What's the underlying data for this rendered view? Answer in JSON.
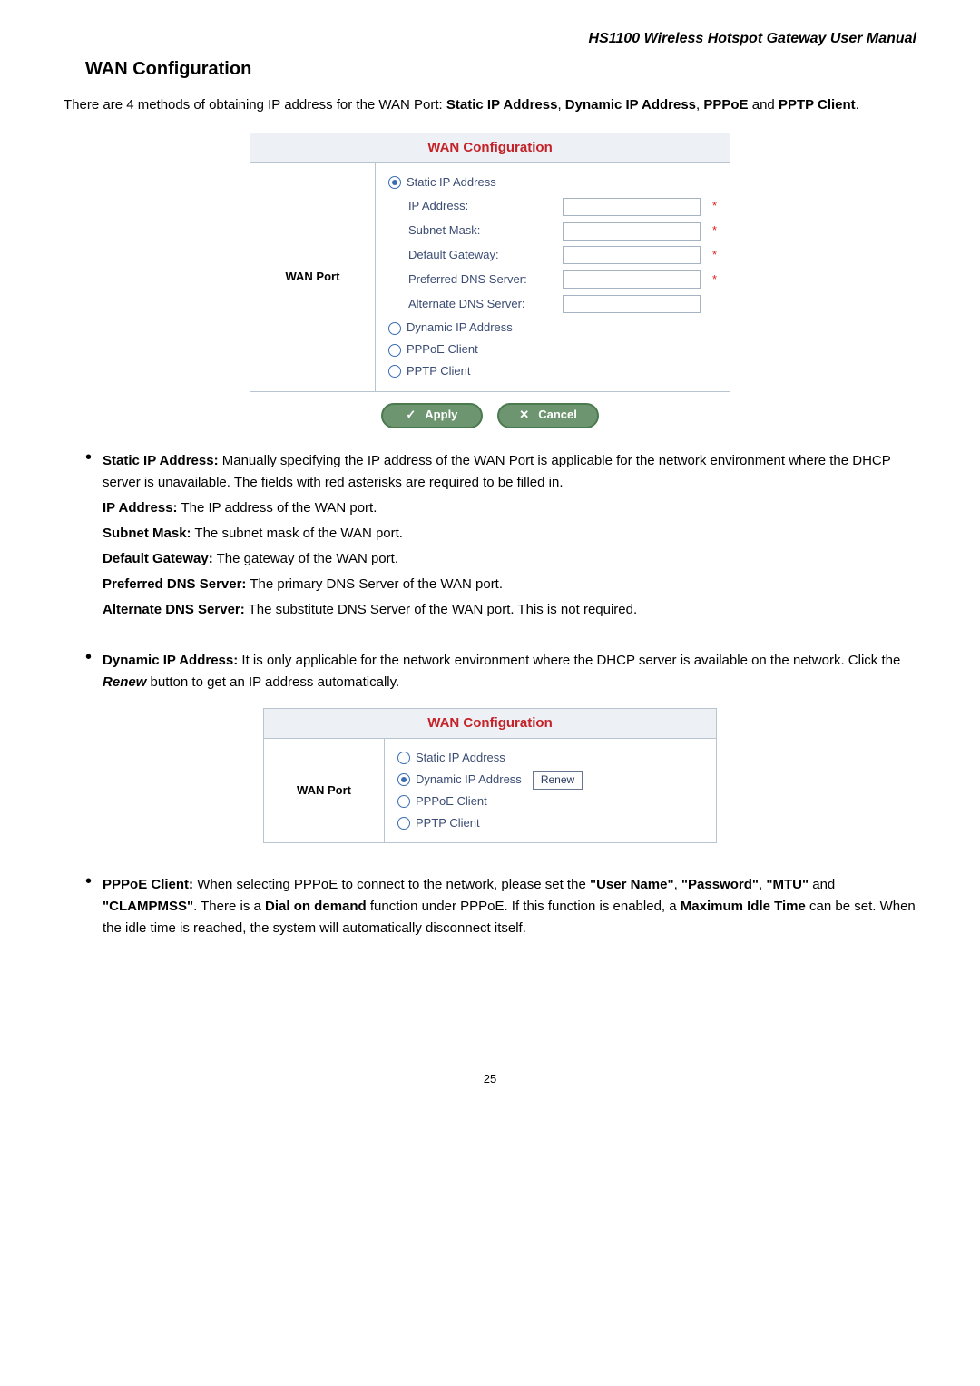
{
  "document_header": "HS1100  Wireless  Hotspot  Gateway  User  Manual",
  "section_title": "WAN Configuration",
  "intro_parts": {
    "p1": "There are 4 methods of obtaining IP address for the WAN Port: ",
    "m1": "Static IP Address",
    "sep1": ", ",
    "m2": "Dynamic IP Address",
    "sep2": ", ",
    "m3": "PPPoE",
    "p2": " and ",
    "m4": "PPTP Client",
    "p3": "."
  },
  "config1": {
    "title": "WAN Configuration",
    "leftlabel": "WAN Port",
    "radios": {
      "static": "Static IP Address",
      "dynamic": "Dynamic IP Address",
      "pppoe": "PPPoE Client",
      "pptp": "PPTP Client"
    },
    "fields": {
      "ip": "IP Address:",
      "subnet": "Subnet Mask:",
      "gateway": "Default Gateway:",
      "pref_dns": "Preferred DNS Server:",
      "alt_dns": "Alternate DNS Server:"
    },
    "apply": "Apply",
    "cancel": "Cancel"
  },
  "static_block": {
    "lead": "Static IP Address:",
    "text1": " Manually specifying the IP address of the WAN Port is applicable for the network environment where the DHCP server is unavailable. The fields with red asterisks are required to be filled in.",
    "ip_lbl": "IP Address:",
    "ip_txt": " The IP address of the WAN port.",
    "subnet_lbl": "Subnet Mask:",
    "subnet_txt": " The subnet mask of the WAN port.",
    "gw_lbl": "Default Gateway:",
    "gw_txt": " The gateway of the WAN port.",
    "pdns_lbl": "Preferred DNS Server:",
    "pdns_txt": " The primary DNS Server of the WAN port.",
    "adns_lbl": "Alternate DNS Server:",
    "adns_txt": " The substitute DNS Server of the WAN port. This is not required."
  },
  "dynamic_block": {
    "lead": "Dynamic IP Address:",
    "text1": " It is only applicable for the network environment where the DHCP server is available on the network. Click the ",
    "renew_word": "Renew",
    "text2": " button to get an IP address automatically."
  },
  "config2": {
    "title": "WAN Configuration",
    "leftlabel": "WAN Port",
    "radios": {
      "static": "Static IP Address",
      "dynamic": "Dynamic IP Address",
      "pppoe": "PPPoE Client",
      "pptp": "PPTP Client"
    },
    "renew_btn": "Renew"
  },
  "pppoe_block": {
    "lead": "PPPoE Client:",
    "t1": " When selecting PPPoE to connect to the network, please set the ",
    "q1": "\"User Name\"",
    "s1": ", ",
    "q2": "\"Password\"",
    "s2": ", ",
    "q3": "\"MTU\"",
    "s3": " and ",
    "q4": "\"CLAMPMSS\"",
    "t2": ". There is a ",
    "dod": "Dial on demand",
    "t3": " function under PPPoE. If this function is enabled, a ",
    "mit": "Maximum Idle Time",
    "t4": " can be set. When the idle time is reached, the system will automatically disconnect itself."
  },
  "page_number": "25",
  "asterisk": "*"
}
